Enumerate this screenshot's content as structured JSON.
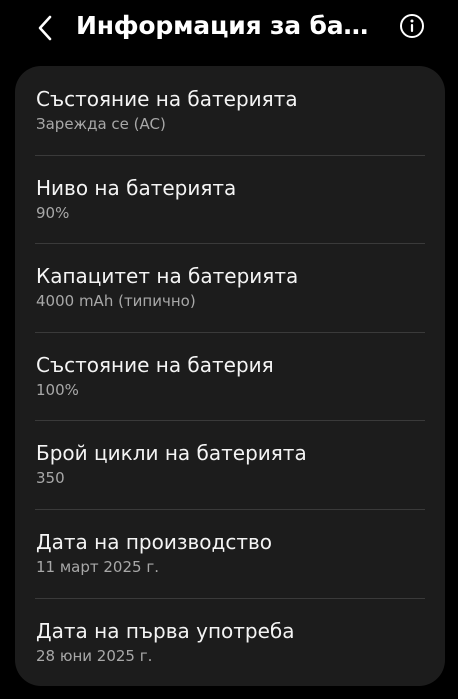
{
  "header": {
    "title": "Информация за бат...",
    "back_icon": "chevron-left-icon",
    "info_icon": "info-circle-icon"
  },
  "battery_info": {
    "items": [
      {
        "label": "Състояние на батерията",
        "value": "Зарежда се (AC)"
      },
      {
        "label": "Ниво на батерията",
        "value": "90%"
      },
      {
        "label": "Капацитет на батерията",
        "value": "4000 mAh (типично)"
      },
      {
        "label": "Състояние на батерия",
        "value": "100%"
      },
      {
        "label": "Брой цикли на батерията",
        "value": "350"
      },
      {
        "label": "Дата на производство",
        "value": "11 март 2025 г."
      },
      {
        "label": "Дата на първа употреба",
        "value": "28 юни 2025 г."
      }
    ]
  },
  "colors": {
    "background": "#000000",
    "card": "#1c1c1c",
    "primary_text": "#f4f4f4",
    "secondary_text": "#a8a8a8",
    "divider": "#3a3a3a"
  }
}
